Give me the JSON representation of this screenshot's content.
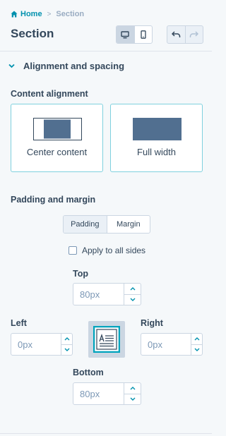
{
  "breadcrumb": {
    "home": "Home",
    "separator": ">",
    "current": "Section"
  },
  "header": {
    "title": "Section",
    "device_modes": [
      "desktop",
      "mobile"
    ],
    "active_device": "desktop"
  },
  "panel": {
    "section_title": "Alignment and spacing",
    "content_alignment": {
      "label": "Content alignment",
      "options": [
        "Center content",
        "Full width"
      ],
      "accent_color": "#516f90"
    },
    "padding_margin": {
      "label": "Padding and margin",
      "tabs": [
        "Padding",
        "Margin"
      ],
      "active_tab": "Padding",
      "apply_all_label": "Apply to all sides",
      "apply_all_checked": false,
      "top": {
        "label": "Top",
        "value": "80px"
      },
      "left": {
        "label": "Left",
        "value": "0px"
      },
      "right": {
        "label": "Right",
        "value": "0px"
      },
      "bottom": {
        "label": "Bottom",
        "value": "80px"
      }
    }
  },
  "colors": {
    "link": "#0091ae",
    "text": "#33475b",
    "border_accent": "#7fd1de",
    "icon_teal": "#00a4bd"
  }
}
